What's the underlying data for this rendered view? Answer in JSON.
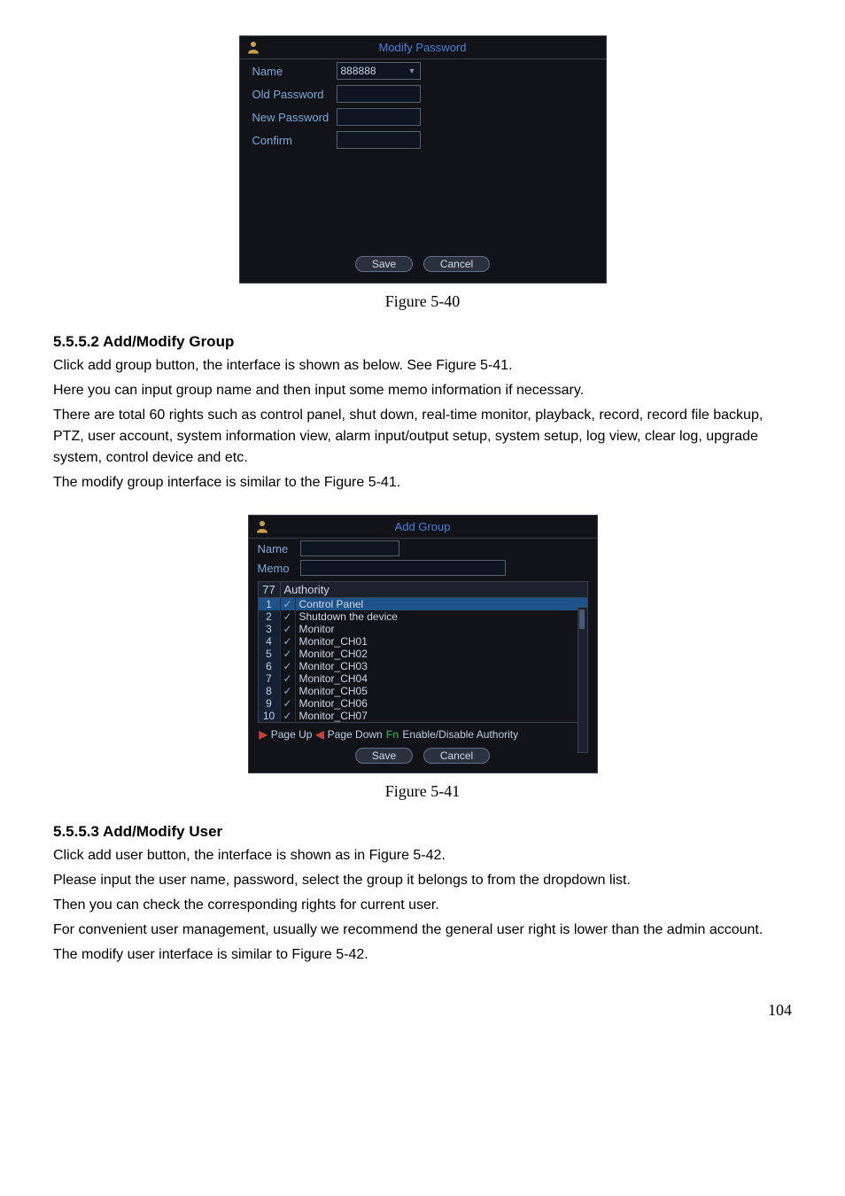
{
  "dialog1": {
    "title": "Modify Password",
    "rows": [
      {
        "label": "Name"
      },
      {
        "label": "Old Password"
      },
      {
        "label": "New Password"
      },
      {
        "label": "Confirm"
      }
    ],
    "name_value": "888888",
    "save": "Save",
    "cancel": "Cancel"
  },
  "caption1": "Figure 5-40",
  "section1": {
    "heading": "5.5.5.2  Add/Modify Group",
    "p1": "Click add group button, the interface is shown as below. See Figure 5-41.",
    "p2": "Here you can input group name and then input some memo information if necessary.",
    "p3": "There are total 60 rights such as control panel, shut down, real-time monitor, playback, record, record file backup, PTZ, user account, system information view, alarm input/output setup, system setup, log view, clear log, upgrade system, control device and etc.",
    "p4": "The modify group interface is similar to the Figure 5-41."
  },
  "dialog2": {
    "title": "Add Group",
    "name_label": "Name",
    "memo_label": "Memo",
    "count": "77",
    "col2": "Authority",
    "rows": [
      {
        "i": "1",
        "t": "Control Panel",
        "sel": true
      },
      {
        "i": "2",
        "t": "Shutdown the device"
      },
      {
        "i": "3",
        "t": "Monitor"
      },
      {
        "i": "4",
        "t": "Monitor_CH01"
      },
      {
        "i": "5",
        "t": "Monitor_CH02"
      },
      {
        "i": "6",
        "t": "Monitor_CH03"
      },
      {
        "i": "7",
        "t": "Monitor_CH04"
      },
      {
        "i": "8",
        "t": "Monitor_CH05"
      },
      {
        "i": "9",
        "t": "Monitor_CH06"
      },
      {
        "i": "10",
        "t": "Monitor_CH07"
      }
    ],
    "pager_up": "Page Up",
    "pager_down": "Page Down",
    "pager_fn": "Enable/Disable Authority",
    "save": "Save",
    "cancel": "Cancel"
  },
  "caption2": "Figure 5-41",
  "section2": {
    "heading": "5.5.5.3  Add/Modify User",
    "p1": "Click add user button, the interface is shown as in Figure 5-42.",
    "p2": "Please input the user name, password, select the group it belongs to from the dropdown list.",
    "p3": "Then you can check the corresponding rights for current user.",
    "p4": "For convenient user management, usually we recommend the general user right is lower than the admin account.",
    "p5": "The modify user interface is similar to Figure 5-42."
  },
  "page_number": "104"
}
